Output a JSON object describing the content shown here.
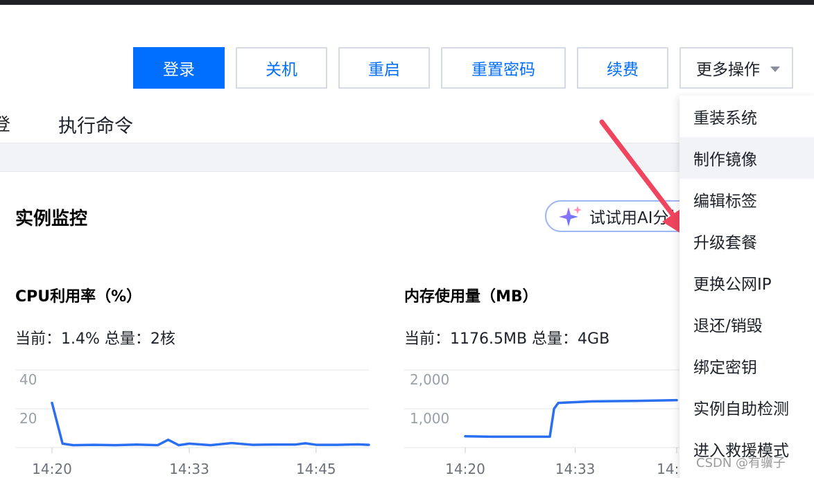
{
  "toolbar": {
    "login": "登录",
    "shutdown": "关机",
    "restart": "重启",
    "reset_password": "重置密码",
    "renew": "续费",
    "more_actions": "更多操作"
  },
  "tabs": {
    "partial": "登",
    "exec": "执行命令"
  },
  "monitor": {
    "title": "实例监控",
    "ai_button": "试试用AI分析"
  },
  "cpu": {
    "title": "CPU利用率（%）",
    "current": "当前：1.4% 总量：2核"
  },
  "memory": {
    "title": "内存使用量（MB）",
    "current": "当前：1176.5MB 总量：4GB"
  },
  "dropdown": {
    "items": [
      "重装系统",
      "制作镜像",
      "编辑标签",
      "升级套餐",
      "更换公网IP",
      "退还/销毁",
      "绑定密钥",
      "实例自助检测",
      "进入救援模式"
    ]
  },
  "watermark": "CSDN @有骥子",
  "colors": {
    "primary": "#006eff",
    "line": "#2b6ef0",
    "arrow": "#f0455f"
  },
  "chart_data": [
    {
      "type": "line",
      "title": "CPU利用率（%）",
      "yticks": [
        "40",
        "20"
      ],
      "xticks": [
        "14:20",
        "14:33",
        "14:45"
      ],
      "ylim": [
        0,
        40
      ],
      "series": [
        {
          "x": [
            "14:20",
            "14:21",
            "14:22",
            "14:24",
            "14:26",
            "14:28",
            "14:30",
            "14:31",
            "14:32",
            "14:33",
            "14:35",
            "14:37",
            "14:39",
            "14:41",
            "14:43",
            "14:44",
            "14:45",
            "14:47",
            "14:49",
            "14:50"
          ],
          "values": [
            23,
            2,
            1.2,
            1.4,
            1.2,
            1.5,
            1.2,
            4,
            1.2,
            2,
            1.2,
            2.3,
            1.4,
            1.5,
            1.5,
            2.2,
            1.4,
            1.4,
            1.6,
            1.4
          ]
        }
      ],
      "grid": true
    },
    {
      "type": "line",
      "title": "内存使用量（MB）",
      "yticks": [
        "2,000",
        "1,000"
      ],
      "xticks": [
        "14:20",
        "14:33",
        "14:45"
      ],
      "ylim": [
        0,
        2000
      ],
      "series": [
        {
          "x": [
            "14:20",
            "14:23",
            "14:26",
            "14:28",
            "14:30",
            "14:30.5",
            "14:31",
            "14:33",
            "14:35",
            "14:40",
            "14:45"
          ],
          "values": [
            290,
            280,
            280,
            280,
            280,
            1000,
            1150,
            1170,
            1190,
            1200,
            1220
          ]
        }
      ],
      "grid": true
    }
  ]
}
